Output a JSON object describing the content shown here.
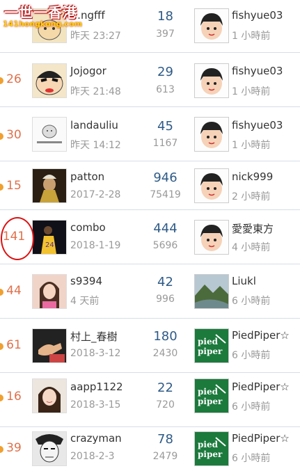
{
  "watermark": {
    "line1": "一世一香港",
    "line2": "141hongkong.com"
  },
  "rows": [
    {
      "score": "",
      "author": "…ngfff",
      "author_time": "昨天 23:27",
      "replies": "18",
      "views": "397",
      "last_user": "fishyue03",
      "last_time": "1 小時前",
      "avatar": "cartoon-sketch-avatar",
      "last_avatar": "cartoon-boy-avatar"
    },
    {
      "score": "26",
      "author": "Jojogor",
      "author_time": "昨天 21:48",
      "replies": "29",
      "views": "613",
      "last_user": "fishyue03",
      "last_time": "1 小時前",
      "avatar": "crayon-shin-chan-avatar",
      "last_avatar": "cartoon-boy-avatar"
    },
    {
      "score": "30",
      "author": "landauliu",
      "author_time": "昨天 14:12",
      "replies": "45",
      "views": "1167",
      "last_user": "fishyue03",
      "last_time": "1 小時前",
      "avatar": "sketch-face-avatar",
      "last_avatar": "cartoon-boy-avatar"
    },
    {
      "score": "15",
      "author": "patton",
      "author_time": "2017-2-28",
      "replies": "946",
      "views": "75419",
      "last_user": "nick999",
      "last_time": "2 小時前",
      "avatar": "costume-character-avatar",
      "last_avatar": "cartoon-boy-avatar"
    },
    {
      "score": "141",
      "author": "combo",
      "author_time": "2018-1-19",
      "replies": "444",
      "views": "5696",
      "last_user": "愛愛東方",
      "last_time": "4 小時前",
      "avatar": "basketball-player-avatar",
      "last_avatar": "cartoon-boy-avatar"
    },
    {
      "score": "44",
      "author": "s9394",
      "author_time": "4 天前",
      "replies": "42",
      "views": "996",
      "last_user": "Liukl",
      "last_time": "6 小時前",
      "avatar": "girl-photo-avatar",
      "last_avatar": "mountain-landscape-avatar"
    },
    {
      "score": "61",
      "author": "村上_春樹",
      "author_time": "2018-3-12",
      "replies": "180",
      "views": "2430",
      "last_user": "PiedPiper☆",
      "last_time": "6 小時前",
      "avatar": "gesture-photo-avatar",
      "last_avatar": "pied-piper-logo-avatar"
    },
    {
      "score": "16",
      "author": "aapp1122",
      "author_time": "2018-3-15",
      "replies": "22",
      "views": "720",
      "last_user": "PiedPiper☆",
      "last_time": "6 小時前",
      "avatar": "woman-photo-avatar",
      "last_avatar": "pied-piper-logo-avatar"
    },
    {
      "score": "39",
      "author": "crazyman",
      "author_time": "2018-2-3",
      "replies": "78",
      "views": "2479",
      "last_user": "PiedPiper☆",
      "last_time": "6 小時前",
      "avatar": "bw-face-drawing-avatar",
      "last_avatar": "pied-piper-logo-avatar"
    }
  ]
}
